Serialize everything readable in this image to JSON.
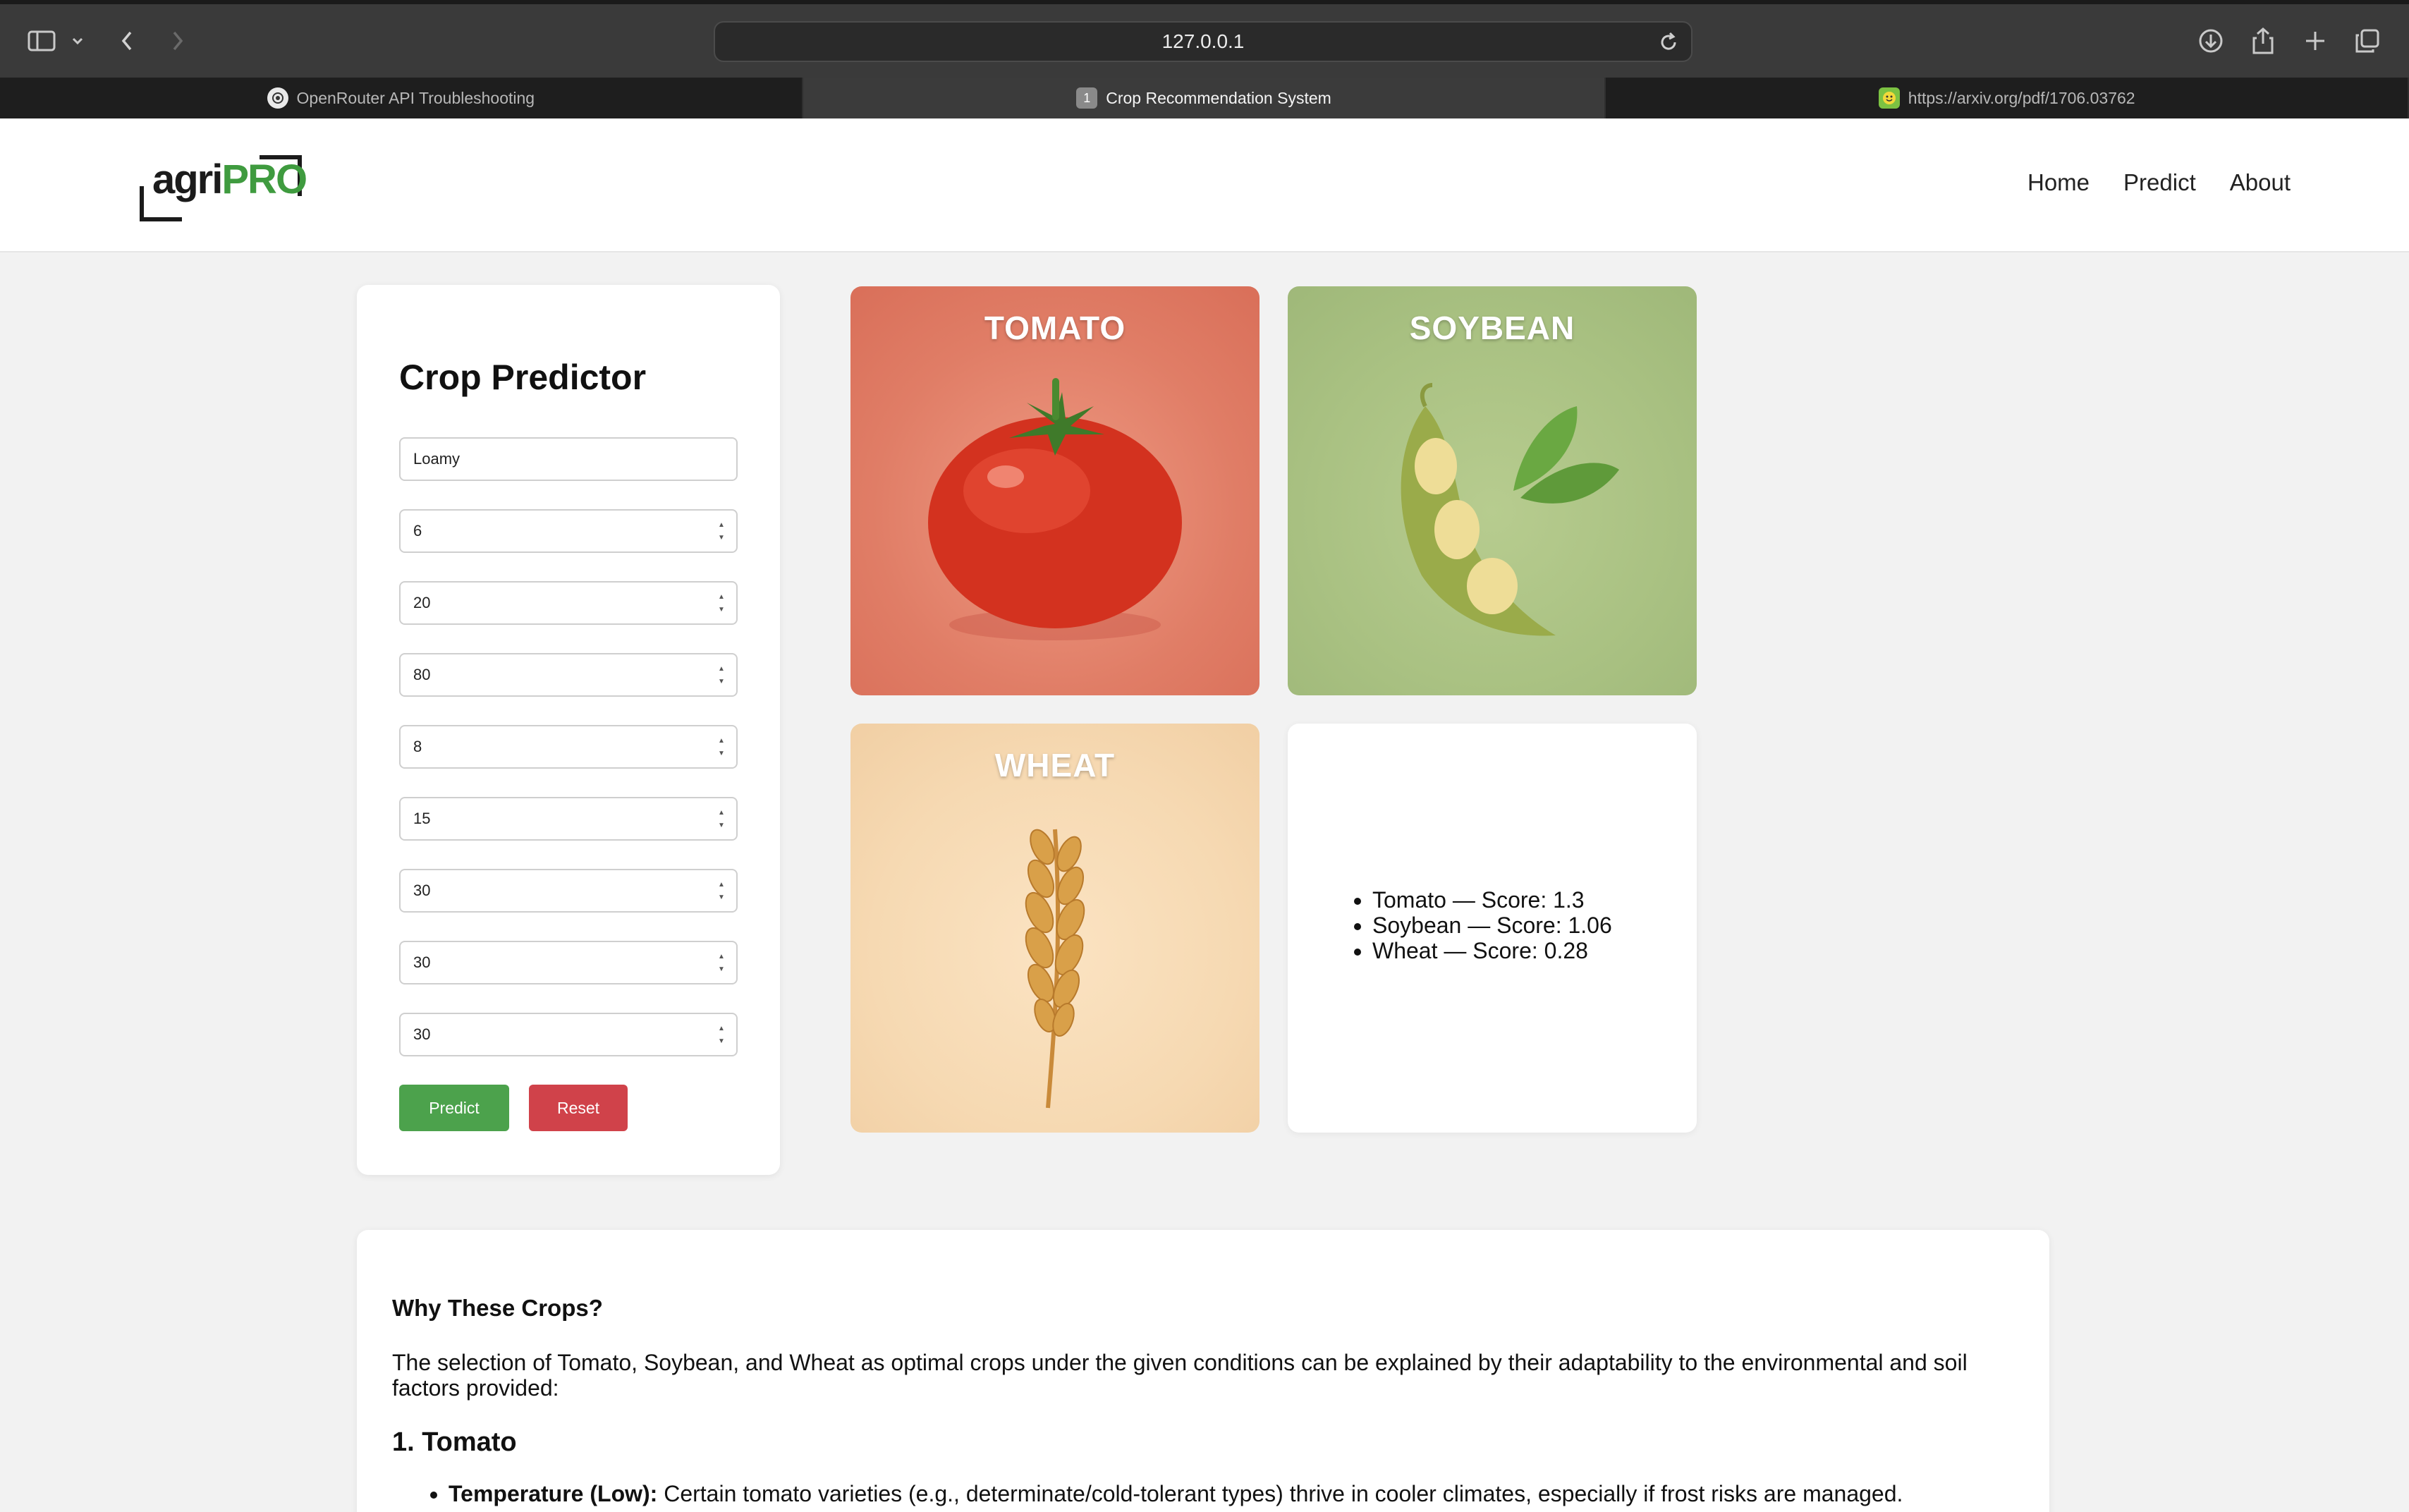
{
  "browser": {
    "url": "127.0.0.1",
    "tabs": [
      {
        "title": "OpenRouter API Troubleshooting",
        "active": false
      },
      {
        "title": "Crop Recommendation System",
        "active": true,
        "badge": "1"
      },
      {
        "title": "https://arxiv.org/pdf/1706.03762",
        "active": false
      }
    ]
  },
  "header": {
    "logo_agri": "agri",
    "logo_pro": "PRO",
    "nav": [
      "Home",
      "Predict",
      "About"
    ]
  },
  "form": {
    "title": "Crop Predictor",
    "soil_value": "Loamy",
    "numeric_values": [
      "6",
      "20",
      "80",
      "8",
      "15",
      "30",
      "30",
      "30"
    ],
    "predict_label": "Predict",
    "reset_label": "Reset"
  },
  "crops": {
    "tomato": "TOMATO",
    "soybean": "SOYBEAN",
    "wheat": "WHEAT"
  },
  "results": [
    "Tomato — Score: 1.3",
    "Soybean — Score: 1.06",
    "Wheat — Score: 0.28"
  ],
  "explanation": {
    "heading": "Why These Crops?",
    "intro": "The selection of Tomato, Soybean, and Wheat as optimal crops under the given conditions can be explained by their adaptability to the environmental and soil factors provided:",
    "subheading": "1. Tomato",
    "bullet_label": "Temperature (Low):",
    "bullet_text": " Certain tomato varieties (e.g., determinate/cold-tolerant types) thrive in cooler climates, especially if frost risks are managed."
  },
  "colors": {
    "accent_green": "#4ca24c",
    "reset_red": "#d0424a",
    "logo_green": "#3f9b3f"
  }
}
